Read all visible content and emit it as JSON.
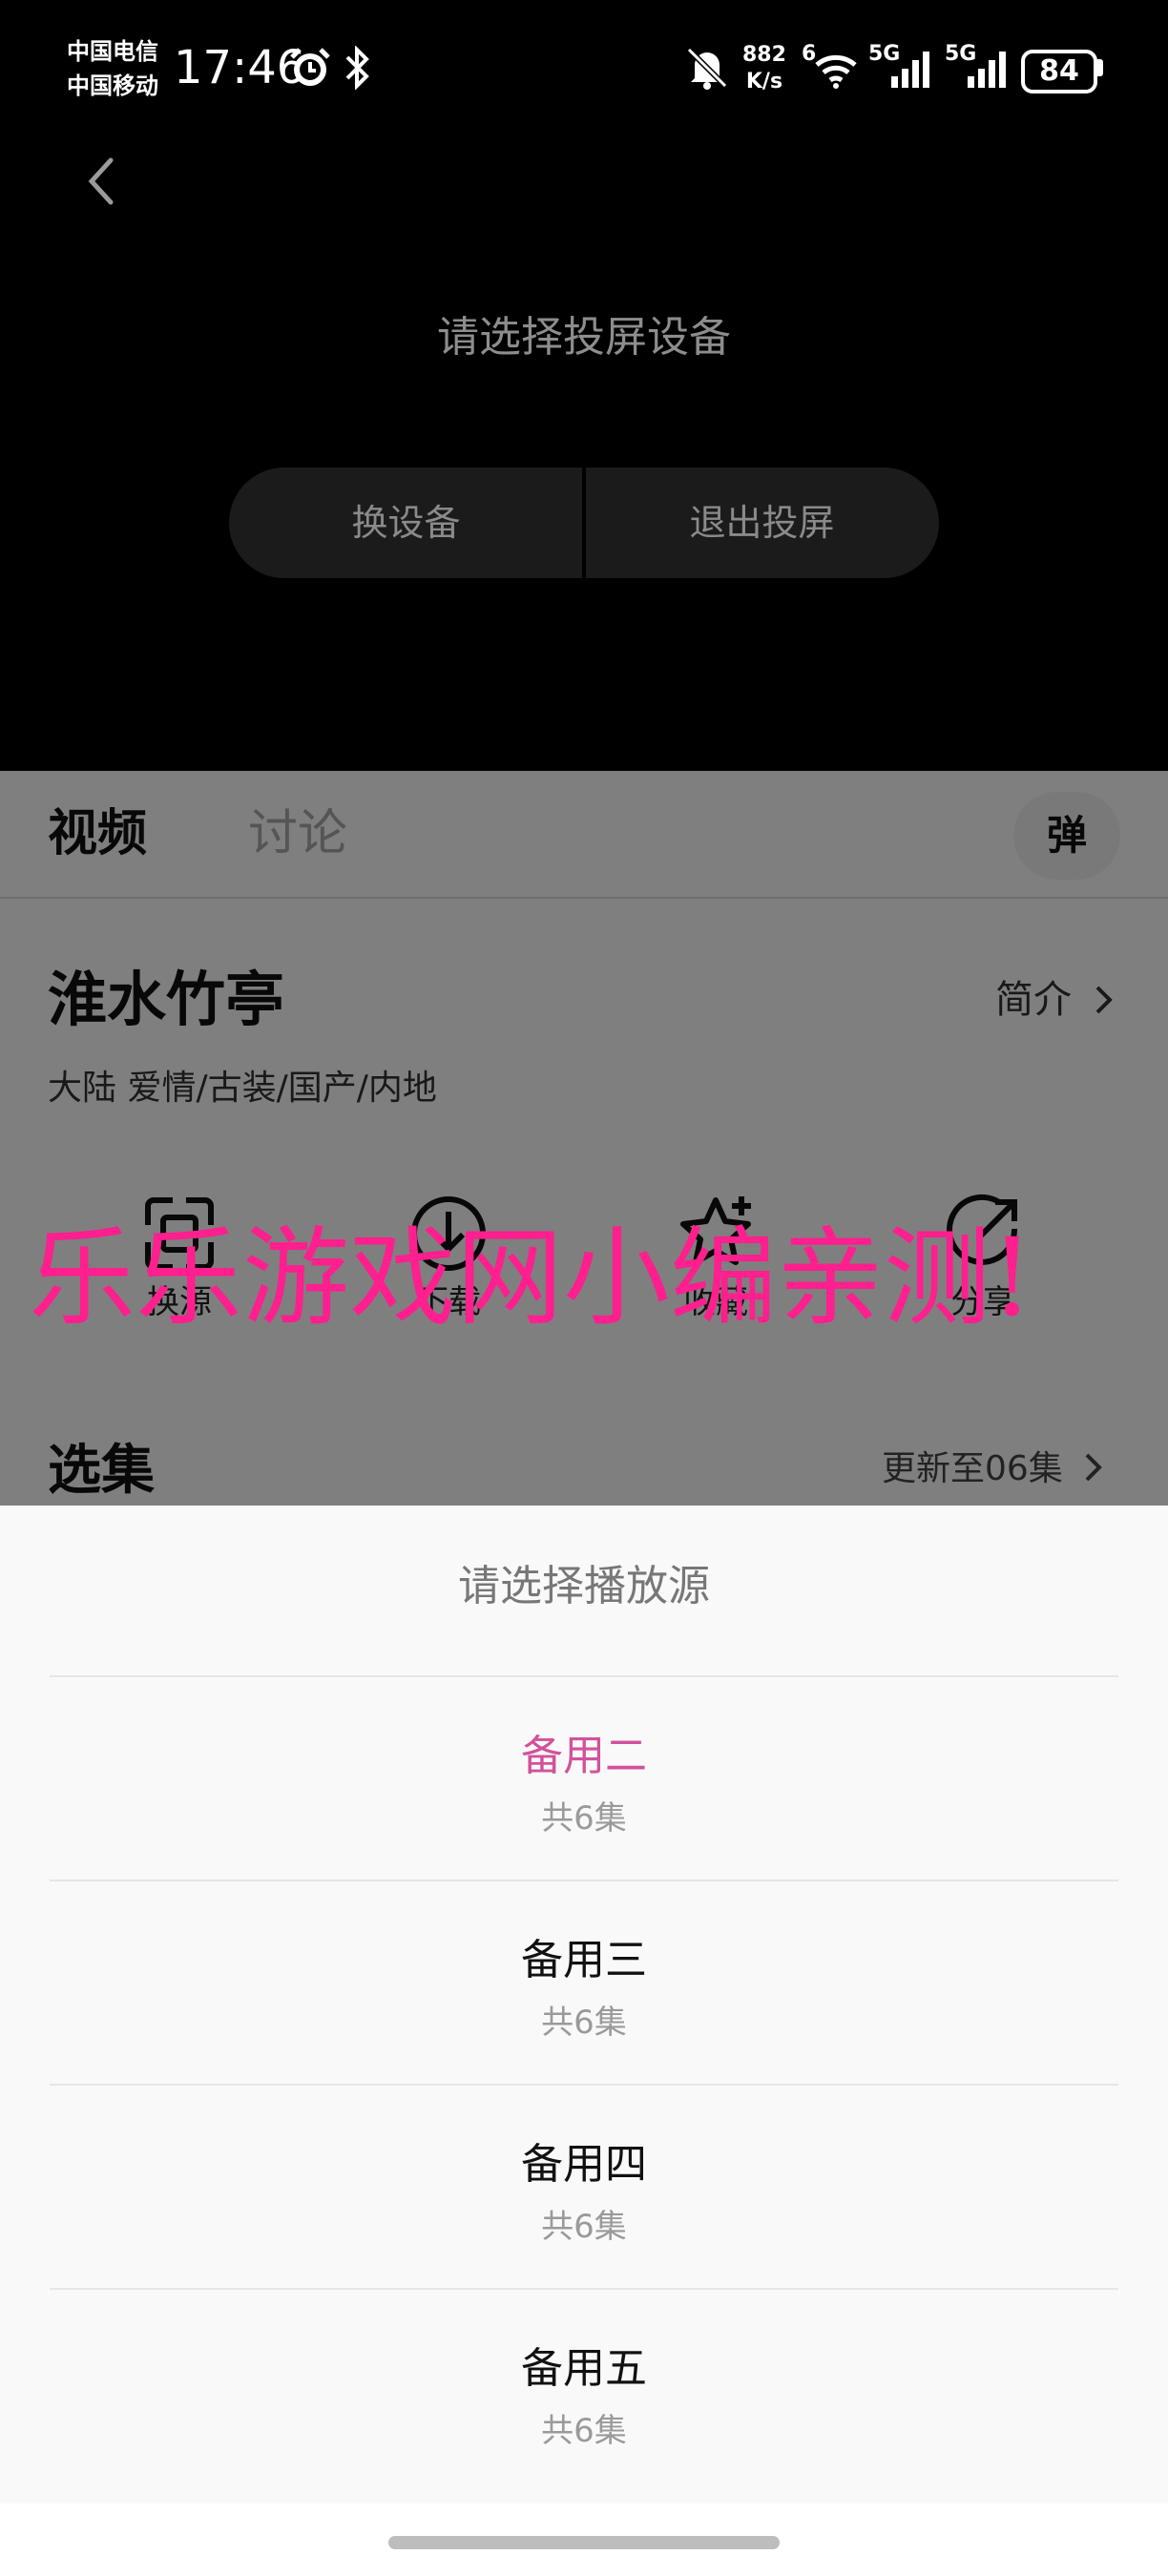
{
  "status_bar": {
    "carrier_1": "中国电信",
    "carrier_2": "中国移动",
    "time": "17:46",
    "net_speed_value": "882",
    "net_speed_unit": "K/s",
    "signal_1": "5G",
    "signal_2": "5G",
    "wifi_label": "6",
    "battery": "84",
    "icons": [
      "alarm-icon",
      "bluetooth-icon",
      "mute-icon",
      "wifi-icon",
      "signal-icon",
      "battery-icon"
    ]
  },
  "cast": {
    "title": "请选择投屏设备",
    "change_device": "换设备",
    "exit_cast": "退出投屏"
  },
  "tabs": {
    "video": "视频",
    "discussion": "讨论",
    "danmu": "弹"
  },
  "show": {
    "title": "淮水竹亭",
    "intro_label": "简介",
    "tags": "大陆  爱情/古装/国产/内地"
  },
  "actions": [
    {
      "label": "换源",
      "icon": "switch-source-icon"
    },
    {
      "label": "下载",
      "icon": "download-icon"
    },
    {
      "label": "收藏",
      "icon": "favorite-star-icon"
    },
    {
      "label": "分享",
      "icon": "share-icon"
    }
  ],
  "episodes": {
    "title": "选集",
    "update": "更新至06集"
  },
  "watermark": "乐乐游戏网小编亲测!",
  "sheet": {
    "title": "请选择播放源",
    "sources": [
      {
        "name": "备用二",
        "count": "共6集",
        "active": true
      },
      {
        "name": "备用三",
        "count": "共6集",
        "active": false
      },
      {
        "name": "备用四",
        "count": "共6集",
        "active": false
      },
      {
        "name": "备用五",
        "count": "共6集",
        "active": false
      }
    ]
  },
  "colors": {
    "accent": "#d2529b",
    "watermark": "#ff1f8e"
  }
}
